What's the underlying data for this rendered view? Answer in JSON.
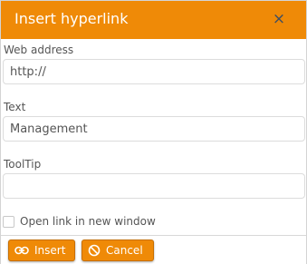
{
  "dialog": {
    "title": "Insert hyperlink",
    "close_glyph": "×"
  },
  "fields": {
    "web_address": {
      "label": "Web address",
      "value": "http://"
    },
    "text": {
      "label": "Text",
      "value": "Management"
    },
    "tooltip": {
      "label": "ToolTip",
      "value": ""
    }
  },
  "open_new_window": {
    "label": "Open link in new window",
    "checked": false
  },
  "buttons": {
    "insert": {
      "label": "Insert",
      "icon": "link-icon"
    },
    "cancel": {
      "label": "Cancel",
      "icon": "cancel-circle-icon"
    }
  },
  "colors": {
    "accent": "#ef8a07",
    "close_icon": "#3d4e63",
    "text": "#555555"
  }
}
